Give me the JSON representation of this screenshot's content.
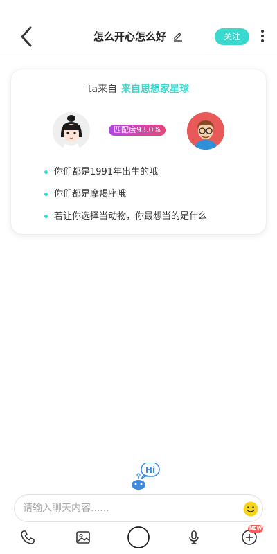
{
  "header": {
    "title": "怎么开心怎么好",
    "follow_label": "关注"
  },
  "match_card": {
    "origin_label": "ta来自",
    "origin_place": "来自思想家星球",
    "match_percent_text": "匹配度93.0%",
    "facts": [
      "你们都是1991年出生的哦",
      "你们都是摩羯座哦",
      "若让你选择当动物，你最想当的是什么"
    ]
  },
  "robot": {
    "bubble_text": "Hi"
  },
  "input": {
    "placeholder": "请输入聊天内容......"
  },
  "toolbar": {
    "items": [
      "phone-icon",
      "image-icon",
      "record-icon",
      "microphone-icon",
      "plus-icon"
    ],
    "new_badge": "NEW"
  },
  "colors": {
    "accent": "#3ad9cf",
    "match_gradient_start": "#b145e6",
    "match_gradient_end": "#e8447a",
    "badge_red": "#ff5a5a"
  }
}
